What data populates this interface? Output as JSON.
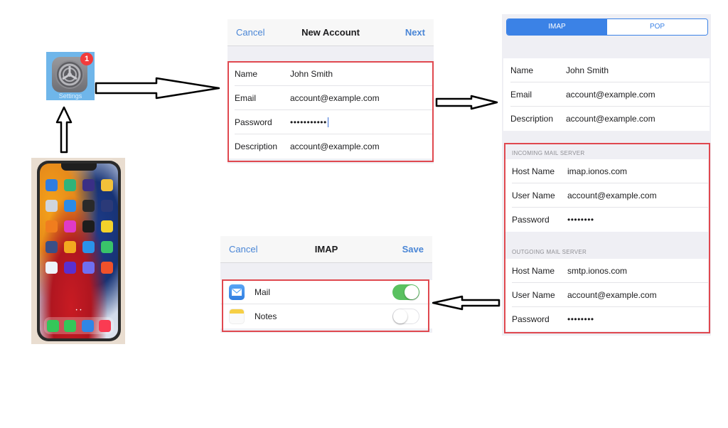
{
  "settings_app": {
    "label": "Settings",
    "badge": "1",
    "icon": "gear-icon"
  },
  "phone": {
    "dots": "• •",
    "apps": [
      "#2f7de0",
      "#2fb37a",
      "#3a2f86",
      "#f2c13a",
      "#cfd5dd",
      "#2b8be8",
      "#2a2a2a",
      "#2b3a78",
      "#f07d1e",
      "#e03ac6",
      "#1d1d1d",
      "#f3d22b",
      "#3a4f86",
      "#f2a81f",
      "#2a93e9",
      "#39c46a",
      "#eef3fb",
      "#5a2fd0",
      "#6f6ff0",
      "#f0512a"
    ],
    "dock": [
      "#34c759",
      "#34c759",
      "#2f86e6",
      "#fa3b52"
    ]
  },
  "new_account": {
    "cancel": "Cancel",
    "title": "New Account",
    "next": "Next",
    "rows": [
      {
        "label": "Name",
        "value": "John Smith"
      },
      {
        "label": "Email",
        "value": "account@example.com"
      },
      {
        "label": "Password",
        "value": "•••••••••••"
      },
      {
        "label": "Description",
        "value": "account@example.com"
      }
    ]
  },
  "server_settings": {
    "segments": [
      "IMAP",
      "POP"
    ],
    "selected_segment": "IMAP",
    "account_rows": [
      {
        "label": "Name",
        "value": "John Smith"
      },
      {
        "label": "Email",
        "value": "account@example.com"
      },
      {
        "label": "Description",
        "value": "account@example.com"
      }
    ],
    "incoming_header": "INCOMING MAIL SERVER",
    "incoming_rows": [
      {
        "label": "Host Name",
        "value": "imap.ionos.com"
      },
      {
        "label": "User Name",
        "value": "account@example.com"
      },
      {
        "label": "Password",
        "value": "••••••••"
      }
    ],
    "outgoing_header": "OUTGOING MAIL SERVER",
    "outgoing_rows": [
      {
        "label": "Host Name",
        "value": "smtp.ionos.com"
      },
      {
        "label": "User Name",
        "value": "account@example.com"
      },
      {
        "label": "Password",
        "value": "••••••••"
      }
    ]
  },
  "imap_sync": {
    "cancel": "Cancel",
    "title": "IMAP",
    "save": "Save",
    "items": [
      {
        "label": "Mail",
        "icon": "mail-icon",
        "enabled": true
      },
      {
        "label": "Notes",
        "icon": "notes-icon",
        "enabled": false
      }
    ]
  },
  "colors": {
    "ios_blue": "#4a86d6",
    "highlight_red": "#e0484f",
    "toggle_green": "#5ac160"
  }
}
